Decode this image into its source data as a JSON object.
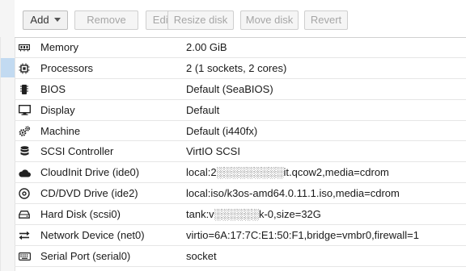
{
  "toolbar": {
    "add_label": "Add",
    "remove_label": "Remove",
    "edit_label": "Edit",
    "resize_label": "Resize disk",
    "move_label": "Move disk",
    "revert_label": "Revert"
  },
  "hardware": [
    {
      "icon": "memory-icon",
      "name": "Memory",
      "value": "2.00 GiB"
    },
    {
      "icon": "cpu-icon",
      "name": "Processors",
      "value": "2 (1 sockets, 2 cores)"
    },
    {
      "icon": "chip-icon",
      "name": "BIOS",
      "value": "Default (SeaBIOS)"
    },
    {
      "icon": "monitor-icon",
      "name": "Display",
      "value": "Default"
    },
    {
      "icon": "gears-icon",
      "name": "Machine",
      "value": "Default (i440fx)"
    },
    {
      "icon": "database-icon",
      "name": "SCSI Controller",
      "value": "VirtIO SCSI"
    },
    {
      "icon": "cloud-icon",
      "name": "CloudInit Drive (ide0)",
      "value": "local:2░░░░░░░░░it.qcow2,media=cdrom"
    },
    {
      "icon": "disc-icon",
      "name": "CD/DVD Drive (ide2)",
      "value": "local:iso/k3os-amd64.0.11.1.iso,media=cdrom"
    },
    {
      "icon": "hdd-icon",
      "name": "Hard Disk (scsi0)",
      "value": "tank:v░░░░░░k-0,size=32G"
    },
    {
      "icon": "exchange-icon",
      "name": "Network Device (net0)",
      "value": "virtio=6A:17:7C:E1:50:F1,bridge=vmbr0,firewall=1"
    },
    {
      "icon": "keyboard-icon",
      "name": "Serial Port (serial0)",
      "value": "socket"
    }
  ]
}
